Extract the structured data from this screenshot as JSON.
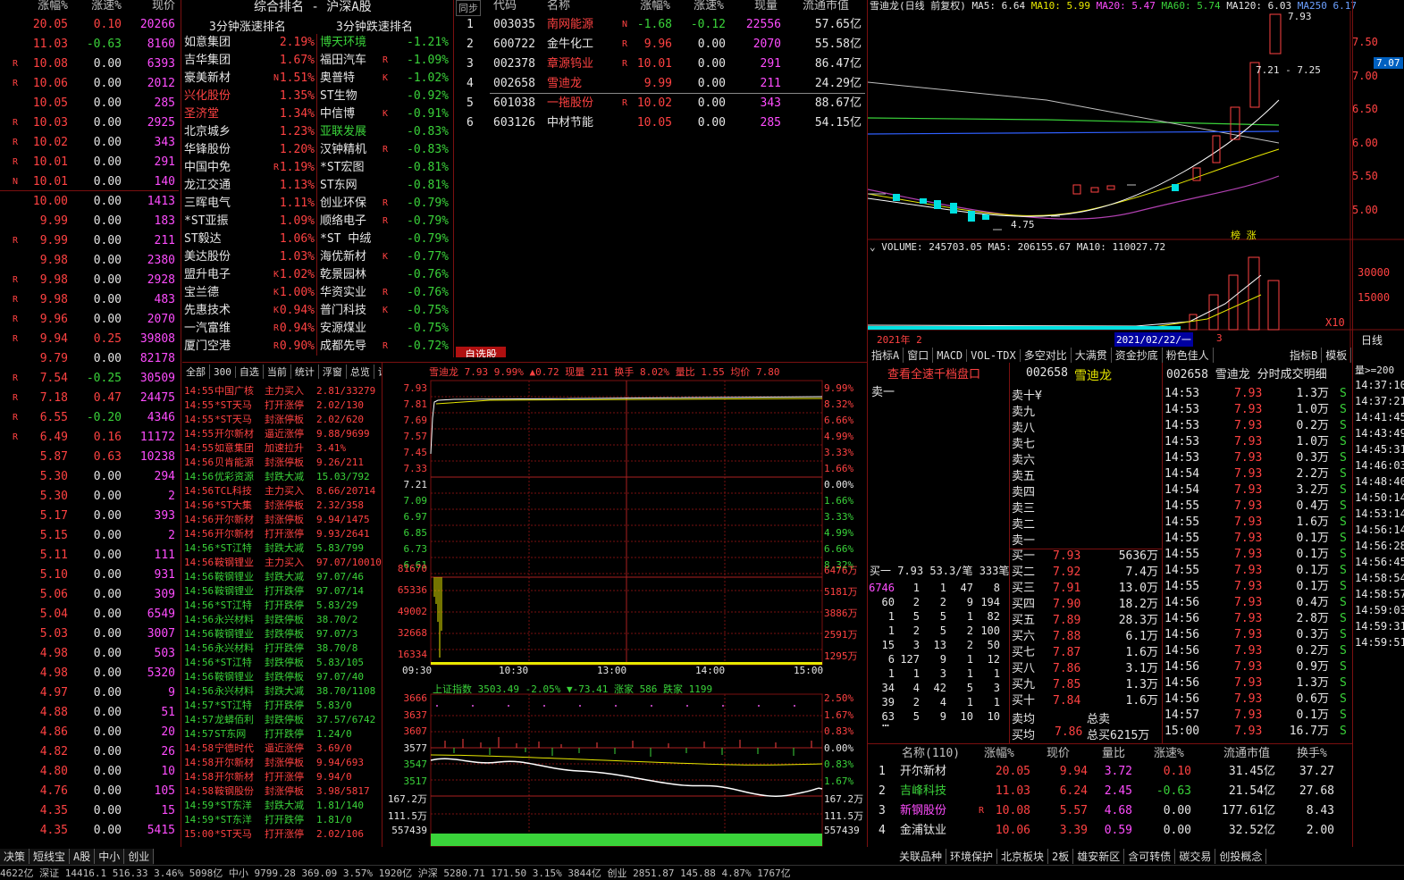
{
  "left_list": {
    "headers": [
      "涨幅%",
      "涨速%",
      "现价"
    ],
    "rows": [
      [
        "",
        "20.05",
        "0.10",
        "20266"
      ],
      [
        "",
        "11.03",
        "-0.63",
        "8160"
      ],
      [
        "R",
        "10.08",
        "0.00",
        "6393"
      ],
      [
        "R",
        "10.06",
        "0.00",
        "2012"
      ],
      [
        "",
        "10.05",
        "0.00",
        "285"
      ],
      [
        "R",
        "10.03",
        "0.00",
        "2925"
      ],
      [
        "R",
        "10.02",
        "0.00",
        "343"
      ],
      [
        "R",
        "10.01",
        "0.00",
        "291"
      ],
      [
        "N",
        "10.01",
        "0.00",
        "140"
      ],
      [
        "",
        "10.00",
        "0.00",
        "1413"
      ],
      [
        "",
        "9.99",
        "0.00",
        "183"
      ],
      [
        "R",
        "9.99",
        "0.00",
        "211"
      ],
      [
        "",
        "9.98",
        "0.00",
        "2380"
      ],
      [
        "R",
        "9.98",
        "0.00",
        "2928"
      ],
      [
        "R",
        "9.98",
        "0.00",
        "483"
      ],
      [
        "R",
        "9.96",
        "0.00",
        "2070"
      ],
      [
        "R",
        "9.94",
        "0.25",
        "39808"
      ],
      [
        "",
        "9.79",
        "0.00",
        "82178"
      ],
      [
        "R",
        "7.54",
        "-0.25",
        "30509"
      ],
      [
        "R",
        "7.18",
        "0.47",
        "24475"
      ],
      [
        "R",
        "6.55",
        "-0.20",
        "4346"
      ],
      [
        "R",
        "6.49",
        "0.16",
        "11172"
      ],
      [
        "",
        "5.87",
        "0.63",
        "10238"
      ],
      [
        "",
        "5.30",
        "0.00",
        "294"
      ],
      [
        "",
        "5.30",
        "0.00",
        "2"
      ],
      [
        "",
        "5.17",
        "0.00",
        "393"
      ],
      [
        "",
        "5.15",
        "0.00",
        "2"
      ],
      [
        "",
        "5.11",
        "0.00",
        "111"
      ],
      [
        "",
        "5.10",
        "0.00",
        "931"
      ],
      [
        "",
        "5.06",
        "0.00",
        "309"
      ],
      [
        "",
        "5.04",
        "0.00",
        "6549"
      ],
      [
        "",
        "5.03",
        "0.00",
        "3007"
      ],
      [
        "",
        "4.98",
        "0.00",
        "503"
      ],
      [
        "",
        "4.98",
        "0.00",
        "5320"
      ],
      [
        "",
        "4.97",
        "0.00",
        "9"
      ],
      [
        "",
        "4.88",
        "0.00",
        "51"
      ],
      [
        "",
        "4.86",
        "0.00",
        "20"
      ],
      [
        "",
        "4.82",
        "0.00",
        "26"
      ],
      [
        "",
        "4.80",
        "0.00",
        "10"
      ],
      [
        "",
        "4.76",
        "0.00",
        "105"
      ],
      [
        "",
        "4.35",
        "0.00",
        "15"
      ],
      [
        "",
        "4.35",
        "0.00",
        "5415"
      ]
    ]
  },
  "rank": {
    "title": "综合排名 - 沪深A股",
    "up_title": "3分钟涨速排名",
    "down_title": "3分钟跌速排名",
    "up": [
      [
        "如意集团",
        "",
        "2.19%"
      ],
      [
        "吉华集团",
        "",
        "1.67%"
      ],
      [
        "豪美新材",
        "N",
        "1.51%"
      ],
      [
        "兴化股份",
        "",
        "1.35%"
      ],
      [
        "圣济堂",
        "",
        "1.34%"
      ],
      [
        "北京城乡",
        "",
        "1.23%"
      ],
      [
        "华锋股份",
        "",
        "1.20%"
      ],
      [
        "中国中免",
        "R",
        "1.19%"
      ],
      [
        "龙江交通",
        "",
        "1.13%"
      ],
      [
        "三晖电气",
        "",
        "1.11%"
      ],
      [
        "*ST亚振",
        "",
        "1.09%"
      ],
      [
        "ST毅达",
        "",
        "1.06%"
      ],
      [
        "美达股份",
        "",
        "1.03%"
      ],
      [
        "盟升电子",
        "K",
        "1.02%"
      ],
      [
        "宝兰德",
        "K",
        "1.00%"
      ],
      [
        "先惠技术",
        "K",
        "0.94%"
      ],
      [
        "一汽富维",
        "R",
        "0.94%"
      ],
      [
        "厦门空港",
        "R",
        "0.90%"
      ]
    ],
    "down": [
      [
        "博天环境",
        "",
        "-1.21%"
      ],
      [
        "福田汽车",
        "R",
        "-1.09%"
      ],
      [
        "奥普特",
        "K",
        "-1.02%"
      ],
      [
        "ST生物",
        "",
        "-0.92%"
      ],
      [
        "中信博",
        "K",
        "-0.91%"
      ],
      [
        "亚联发展",
        "",
        "-0.83%"
      ],
      [
        "汉钟精机",
        "R",
        "-0.83%"
      ],
      [
        "*ST宏图",
        "",
        "-0.81%"
      ],
      [
        "ST东网",
        "",
        "-0.81%"
      ],
      [
        "创业环保",
        "R",
        "-0.79%"
      ],
      [
        "顺络电子",
        "R",
        "-0.79%"
      ],
      [
        "*ST 中绒",
        "",
        "-0.79%"
      ],
      [
        "海优新材",
        "K",
        "-0.77%"
      ],
      [
        "乾景园林",
        "",
        "-0.76%"
      ],
      [
        "华资实业",
        "R",
        "-0.76%"
      ],
      [
        "普门科技",
        "K",
        "-0.75%"
      ],
      [
        "安源煤业",
        "",
        "-0.75%"
      ],
      [
        "成都先导",
        "R",
        "-0.72%"
      ]
    ]
  },
  "watch": {
    "sync": "同步",
    "headers": [
      "代码",
      "名称",
      "涨幅%",
      "涨速%",
      "现量",
      "流通市值"
    ],
    "rows": [
      [
        "1",
        "003035",
        "南网能源",
        "N",
        "-1.68",
        "-0.12",
        "22556",
        "57.65亿"
      ],
      [
        "2",
        "600722",
        "金牛化工",
        "R",
        "9.96",
        "0.00",
        "2070",
        "55.58亿"
      ],
      [
        "3",
        "002378",
        "章源钨业",
        "R",
        "10.01",
        "0.00",
        "291",
        "86.47亿"
      ],
      [
        "4",
        "002658",
        "雪迪龙",
        "",
        "9.99",
        "0.00",
        "211",
        "24.29亿"
      ],
      [
        "5",
        "601038",
        "一拖股份",
        "R",
        "10.02",
        "0.00",
        "343",
        "88.67亿"
      ],
      [
        "6",
        "603126",
        "中材节能",
        "",
        "10.05",
        "0.00",
        "285",
        "54.15亿"
      ]
    ],
    "tab": "自选股"
  },
  "kline": {
    "title": "雪迪龙(日线 前复权)",
    "ma5": "MA5: 6.64",
    "ma10": "MA10: 5.99",
    "ma20": "MA20: 5.47",
    "ma60": "MA60: 5.74",
    "ma120": "MA120: 6.03",
    "ma250": "MA250 6.17",
    "high": "7.93",
    "low": "4.75",
    "range": "7.21 - 7.25",
    "price_tag": "7.07",
    "marks": "榜 涨",
    "yticks": [
      "7.50",
      "7.00",
      "6.50",
      "6.00",
      "5.50",
      "5.00"
    ],
    "volume": "VOLUME: 245703.05  MA5: 206155.67  MA10: 110027.72",
    "vticks": [
      "30000",
      "15000",
      "X10"
    ],
    "date1": "2021年 2",
    "date2": "2021/02/22/一",
    "date3": "3",
    "period": "日线",
    "tabs": [
      "指标A",
      "窗口",
      "MACD",
      "VOL-TDX",
      "多空对比",
      "大满贯",
      "资金抄底",
      "粉色佳人"
    ],
    "tabs_right": [
      "指标B",
      "模板"
    ]
  },
  "ticker": {
    "tabs": [
      "全部",
      "300",
      "自选",
      "当前",
      "统计",
      "浮窗",
      "总览",
      "设置"
    ],
    "rows": [
      [
        "14:55",
        "中国广核",
        "主力买入",
        "2.81/33279"
      ],
      [
        "14:55",
        "*ST天马",
        "打开涨停",
        "2.02/130"
      ],
      [
        "14:55",
        "*ST天马",
        "封涨停板",
        "2.02/620"
      ],
      [
        "14:55",
        "开尔新材",
        "逼近涨停",
        "9.88/9699"
      ],
      [
        "14:55",
        "如意集团",
        "加速拉升",
        "3.41%"
      ],
      [
        "14:56",
        "贝肯能源",
        "封涨停板",
        "9.26/211"
      ],
      [
        "14:56",
        "优彩资源",
        "封跌大减",
        "15.03/792"
      ],
      [
        "14:56",
        "TCL科技",
        "主力买入",
        "8.66/20714"
      ],
      [
        "14:56",
        "*ST大集",
        "封涨停板",
        "2.32/358"
      ],
      [
        "14:56",
        "开尔新材",
        "封涨停板",
        "9.94/1475"
      ],
      [
        "14:56",
        "开尔新材",
        "打开涨停",
        "9.93/2641"
      ],
      [
        "14:56",
        "*ST江特",
        "封跌大减",
        "5.83/799"
      ],
      [
        "14:56",
        "鞍钢锂业",
        "主力买入",
        "97.07/10010"
      ],
      [
        "14:56",
        "鞍钢锂业",
        "封跌大减",
        "97.07/46"
      ],
      [
        "14:56",
        "鞍钢锂业",
        "打开跌停",
        "97.07/14"
      ],
      [
        "14:56",
        "*ST江特",
        "打开跌停",
        "5.83/29"
      ],
      [
        "14:56",
        "永兴材料",
        "封跌停板",
        "38.70/2"
      ],
      [
        "14:56",
        "鞍钢锂业",
        "封跌停板",
        "97.07/3"
      ],
      [
        "14:56",
        "永兴材料",
        "打开跌停",
        "38.70/8"
      ],
      [
        "14:56",
        "*ST江特",
        "封跌停板",
        "5.83/105"
      ],
      [
        "14:56",
        "鞍钢锂业",
        "封跌停板",
        "97.07/40"
      ],
      [
        "14:56",
        "永兴材料",
        "封跌大减",
        "38.70/1108"
      ],
      [
        "14:57",
        "*ST江特",
        "打开跌停",
        "5.83/0"
      ],
      [
        "14:57",
        "龙蟒佰利",
        "封跌停板",
        "37.57/6742"
      ],
      [
        "14:57",
        "ST东网",
        "打开跌停",
        "1.24/0"
      ],
      [
        "14:58",
        "宁德时代",
        "逼近涨停",
        "3.69/0"
      ],
      [
        "14:58",
        "开尔新材",
        "封涨停板",
        "9.94/693"
      ],
      [
        "14:58",
        "开尔新材",
        "打开涨停",
        "9.94/0"
      ],
      [
        "14:58",
        "鞍钢股份",
        "封涨停板",
        "3.98/5817"
      ],
      [
        "14:59",
        "*ST东洋",
        "封跌大减",
        "1.81/140"
      ],
      [
        "14:59",
        "*ST东洋",
        "打开跌停",
        "1.81/0"
      ],
      [
        "15:00",
        "*ST天马",
        "打开涨停",
        "2.02/106"
      ]
    ]
  },
  "intraday": {
    "header": "雪迪龙  7.93  9.99%  ▲0.72  现量 211  换手 8.02%  量比 1.55  均价 7.80",
    "left": [
      "7.93",
      "7.81",
      "7.69",
      "7.57",
      "7.45",
      "7.33",
      "7.21",
      "7.09",
      "6.97",
      "6.85",
      "6.73",
      "6.61"
    ],
    "right": [
      "9.99%",
      "8.32%",
      "6.66%",
      "4.99%",
      "3.33%",
      "1.66%",
      "0.00%",
      "1.66%",
      "3.33%",
      "4.99%",
      "6.66%",
      "8.32%"
    ],
    "vleft": [
      "81670",
      "65336",
      "49002",
      "32668",
      "16334"
    ],
    "vright": [
      "6476万",
      "5181万",
      "3886万",
      "2591万",
      "1295万"
    ],
    "times": [
      "09:30",
      "10:30",
      "13:00",
      "14:00",
      "15:00"
    ]
  },
  "index": {
    "header": "上证指数  3503.49 -2.05% ▼-73.41  涨家 586  跌家 1199",
    "left": [
      "3666",
      "3637",
      "3607",
      "3577",
      "3547",
      "3517",
      "167.2万",
      "111.5万",
      "557439"
    ],
    "right": [
      "2.50%",
      "1.67%",
      "0.83%",
      "0.00%",
      "0.83%",
      "1.67%",
      "167.2万",
      "111.5万",
      "557439"
    ],
    "times": [
      "09:30",
      "10:30",
      "13:00",
      "14:00",
      "15:00"
    ]
  },
  "orderbook": {
    "title": "查看全速千档盘口",
    "sell1": "卖一",
    "buy_summary": "买一 7.93 53.3/笔 333笔",
    "queue": [
      [
        "6746",
        "1",
        "1",
        "47",
        "8"
      ],
      [
        "60",
        "2",
        "2",
        "9",
        "194"
      ],
      [
        "1",
        "5",
        "5",
        "1",
        "82"
      ],
      [
        "1",
        "2",
        "5",
        "2",
        "100"
      ],
      [
        "15",
        "3",
        "13",
        "2",
        "50"
      ],
      [
        "6",
        "127",
        "9",
        "1",
        "12"
      ],
      [
        "1",
        "1",
        "3",
        "1",
        "1"
      ],
      [
        "34",
        "4",
        "42",
        "5",
        "3"
      ],
      [
        "39",
        "2",
        "4",
        "1",
        "1"
      ],
      [
        "63",
        "5",
        "9",
        "10",
        "10"
      ]
    ],
    "ellipsis": "…"
  },
  "quote": {
    "code": "002658",
    "name": "雪迪龙",
    "sells": [
      "卖十¥",
      "卖九",
      "卖八",
      "卖七",
      "卖六",
      "卖五",
      "卖四",
      "卖三",
      "卖二",
      "卖一"
    ],
    "buys": [
      [
        "买一",
        "7.93",
        "5636万"
      ],
      [
        "买二",
        "7.92",
        "7.4万"
      ],
      [
        "买三",
        "7.91",
        "13.0万"
      ],
      [
        "买四",
        "7.90",
        "18.2万"
      ],
      [
        "买五",
        "7.89",
        "28.3万"
      ],
      [
        "买六",
        "7.88",
        "6.1万"
      ],
      [
        "买七",
        "7.87",
        "1.6万"
      ],
      [
        "买八",
        "7.86",
        "3.1万"
      ],
      [
        "买九",
        "7.85",
        "1.3万"
      ],
      [
        "买十",
        "7.84",
        "1.6万"
      ]
    ],
    "sell_avg": "卖均",
    "total_sell": "总卖",
    "buy_avg": "买均",
    "buy_avg_val": "7.86",
    "total_buy": "总买6215万"
  },
  "trades": {
    "title": "002658  雪迪龙  分时成交明细",
    "rows": [
      [
        "14:53",
        "7.93",
        "1.3万",
        "S"
      ],
      [
        "14:53",
        "7.93",
        "1.0万",
        "S"
      ],
      [
        "14:53",
        "7.93",
        "0.2万",
        "S"
      ],
      [
        "14:53",
        "7.93",
        "1.0万",
        "S"
      ],
      [
        "14:53",
        "7.93",
        "0.3万",
        "S"
      ],
      [
        "14:54",
        "7.93",
        "2.2万",
        "S"
      ],
      [
        "14:54",
        "7.93",
        "3.2万",
        "S"
      ],
      [
        "14:55",
        "7.93",
        "0.4万",
        "S"
      ],
      [
        "14:55",
        "7.93",
        "1.6万",
        "S"
      ],
      [
        "14:55",
        "7.93",
        "0.1万",
        "S"
      ],
      [
        "14:55",
        "7.93",
        "0.1万",
        "S"
      ],
      [
        "14:55",
        "7.93",
        "0.1万",
        "S"
      ],
      [
        "14:55",
        "7.93",
        "0.1万",
        "S"
      ],
      [
        "14:56",
        "7.93",
        "0.4万",
        "S"
      ],
      [
        "14:56",
        "7.93",
        "2.8万",
        "S"
      ],
      [
        "14:56",
        "7.93",
        "0.3万",
        "S"
      ],
      [
        "14:56",
        "7.93",
        "0.2万",
        "S"
      ],
      [
        "14:56",
        "7.93",
        "0.9万",
        "S"
      ],
      [
        "14:56",
        "7.93",
        "1.3万",
        "S"
      ],
      [
        "14:56",
        "7.93",
        "0.6万",
        "S"
      ],
      [
        "14:57",
        "7.93",
        "0.1万",
        "S"
      ],
      [
        "15:00",
        "7.93",
        "16.7万",
        "S"
      ]
    ]
  },
  "side_times": {
    "header": "量>=200",
    "rows": [
      "14:37:10",
      "14:37:21",
      "14:41:45",
      "14:43:49",
      "14:45:31",
      "14:46:03",
      "14:48:40",
      "14:50:14",
      "14:53:14",
      "14:56:14",
      "14:56:28",
      "14:56:45",
      "14:58:54",
      "14:58:57",
      "14:59:03",
      "14:59:31",
      "14:59:51"
    ]
  },
  "sector": {
    "headers": [
      "名称(110)",
      "涨幅%",
      "现价",
      "量比",
      "涨速%",
      "流通市值",
      "换手%"
    ],
    "rows": [
      [
        "1",
        "开尔新材",
        "",
        "20.05",
        "9.94",
        "3.72",
        "0.10",
        "31.45亿",
        "37.27"
      ],
      [
        "2",
        "吉峰科技",
        "",
        "11.03",
        "6.24",
        "2.45",
        "-0.63",
        "21.54亿",
        "27.68"
      ],
      [
        "3",
        "新钢股份",
        "R",
        "10.08",
        "5.57",
        "4.68",
        "0.00",
        "177.61亿",
        "8.43"
      ],
      [
        "4",
        "金浦钛业",
        "",
        "10.06",
        "3.39",
        "0.59",
        "0.00",
        "32.52亿",
        "2.00"
      ]
    ]
  },
  "bottom_tabs": [
    "决策",
    "短线宝",
    "A股",
    "中小",
    "创业"
  ],
  "right_tabs": [
    "关联品种",
    "环境保护",
    "北京板块",
    "2板",
    "雄安新区",
    "含可转债",
    "碳交易",
    "创投概念"
  ],
  "status": "4622亿  深证 14416.1  516.33  3.46%  5098亿  中小 9799.28  369.09  3.57%  1920亿  沪深 5280.71  171.50  3.15%  3844亿  创业 2851.87  145.88  4.87%  1767亿"
}
